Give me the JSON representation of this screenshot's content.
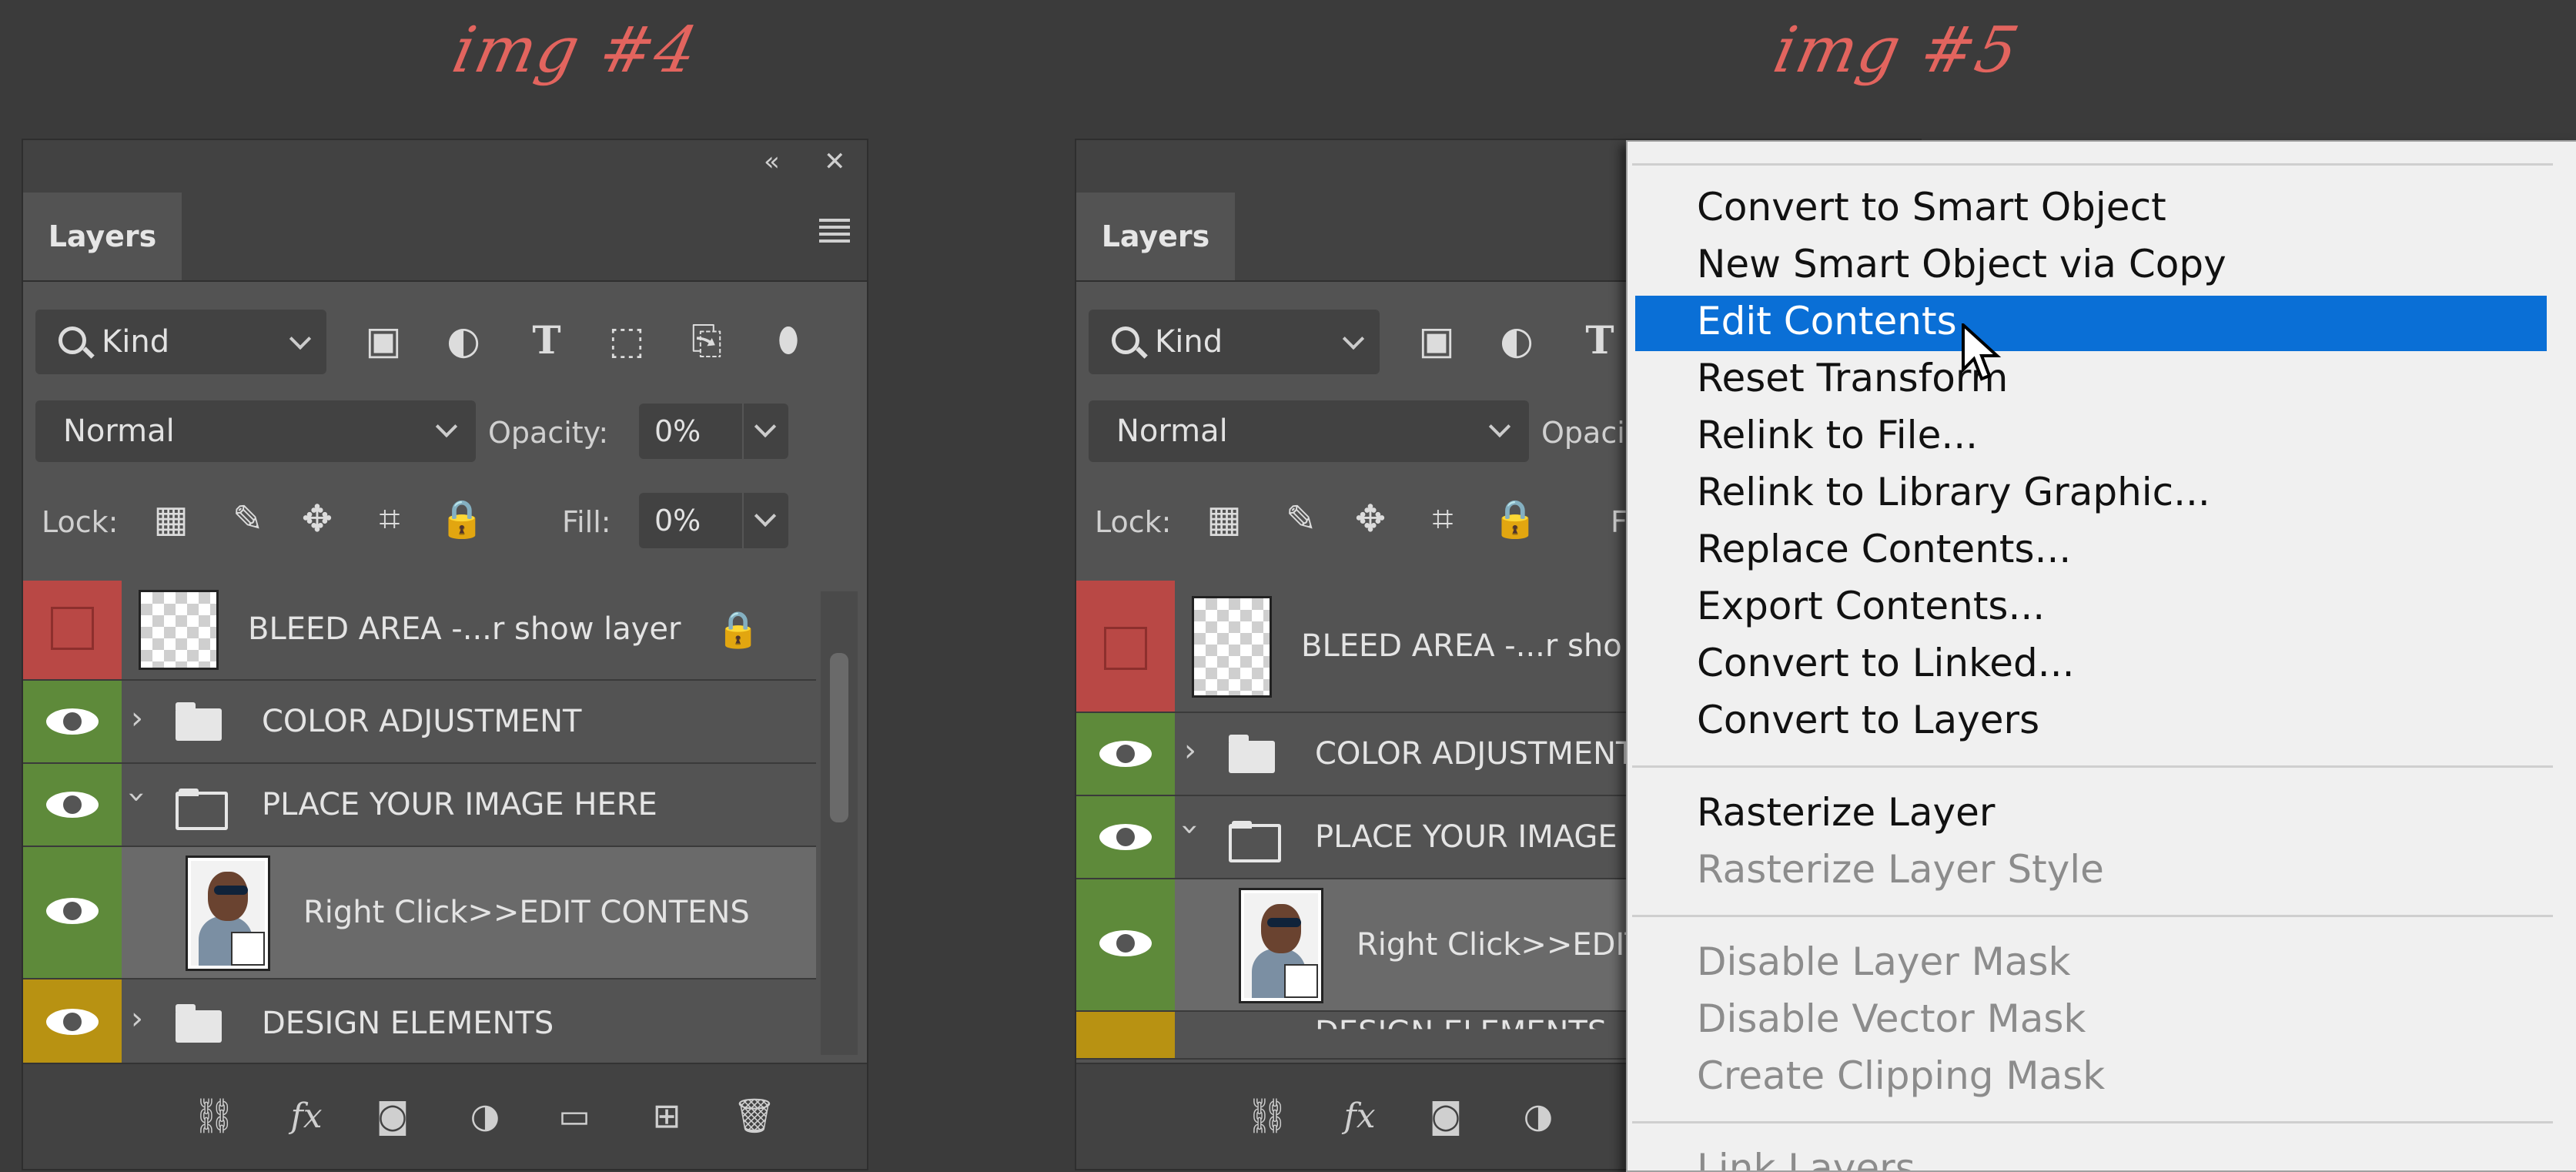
{
  "captions": {
    "left": "img #4",
    "right": "img #5"
  },
  "panel": {
    "tab_label": "Layers",
    "filter_kind": "Kind",
    "blend_mode": "Normal",
    "opacity_label": "Opacity:",
    "opacity_value": "0%",
    "lock_label": "Lock:",
    "fill_label": "Fill:",
    "fill_value": "0%",
    "collapse_glyph": "«",
    "close_glyph": "✕"
  },
  "layers": [
    {
      "name": "BLEED AREA -...r show layer",
      "color": "#b94845",
      "visible": false,
      "locked": true
    },
    {
      "name": "COLOR ADJUSTMENT",
      "color": "#5e8a3a",
      "visible": true,
      "type": "folder",
      "expanded": false
    },
    {
      "name": "PLACE YOUR IMAGE HERE",
      "color": "#5e8a3a",
      "visible": true,
      "type": "folder",
      "expanded": true
    },
    {
      "name": "Right Click>>EDIT CONTENS",
      "color": "#5e8a3a",
      "visible": true,
      "type": "smart-object"
    },
    {
      "name": "DESIGN ELEMENTS",
      "color": "#b89212",
      "visible": true,
      "type": "folder",
      "expanded": false
    }
  ],
  "right_panel_truncated": {
    "opacity_label": "Opaci",
    "fill_label": "F",
    "layer0": "BLEED AREA -...r sho",
    "layer1": "COLOR ADJUSTMENT",
    "layer2": "PLACE YOUR IMAGE",
    "layer3": "Right Click>>EDIT",
    "layer4": "DESIGN ELEMENTS"
  },
  "context_menu": {
    "items": [
      {
        "label": "Convert to Smart Object",
        "disabled": false
      },
      {
        "label": "New Smart Object via Copy",
        "disabled": false
      },
      {
        "label": "Edit Contents",
        "disabled": false,
        "highlighted": true
      },
      {
        "label": "Reset Transform",
        "disabled": false
      },
      {
        "label": "Relink to File...",
        "disabled": false
      },
      {
        "label": "Relink to Library Graphic...",
        "disabled": false
      },
      {
        "label": "Replace Contents...",
        "disabled": false
      },
      {
        "label": "Export Contents...",
        "disabled": false
      },
      {
        "label": "Convert to Linked...",
        "disabled": false
      },
      {
        "label": "Convert to Layers",
        "disabled": false
      },
      {
        "label": "Rasterize Layer",
        "disabled": false
      },
      {
        "label": "Rasterize Layer Style",
        "disabled": true
      },
      {
        "label": "Disable Layer Mask",
        "disabled": true
      },
      {
        "label": "Disable Vector Mask",
        "disabled": true
      },
      {
        "label": "Create Clipping Mask",
        "disabled": true
      },
      {
        "label": "Link Layers",
        "disabled": true
      }
    ],
    "highlight_color": "#0a6fd6"
  },
  "colors": {
    "caption": "#e2645e",
    "panel_bg": "#535353",
    "panel_dark": "#424242",
    "menu_bg": "#f0f0f0"
  }
}
